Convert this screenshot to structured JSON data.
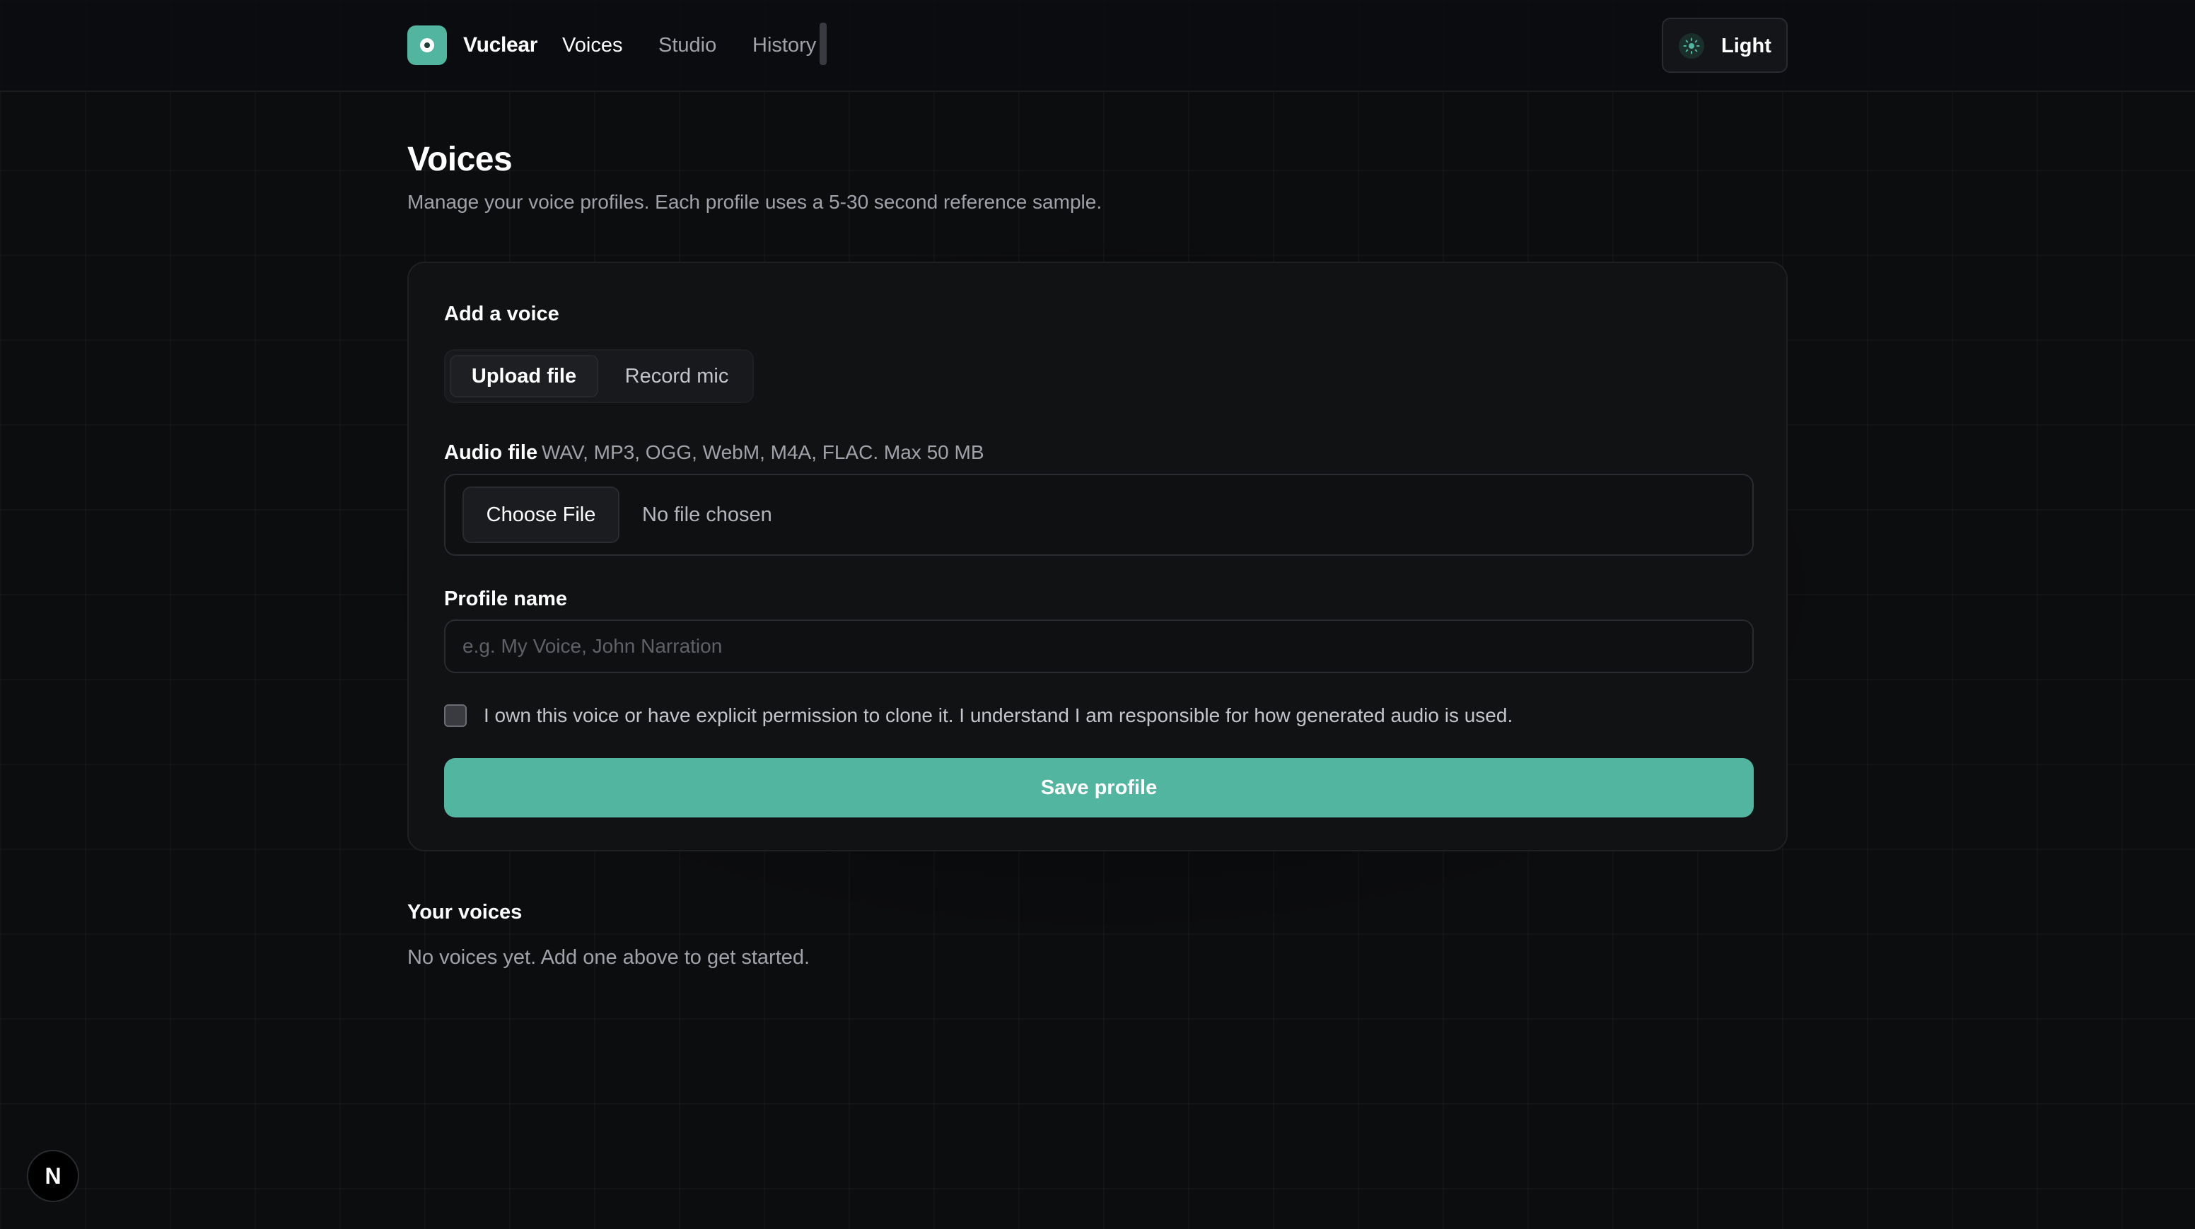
{
  "header": {
    "brand": "Vuclear",
    "nav": [
      {
        "label": "Voices",
        "active": true
      },
      {
        "label": "Studio",
        "active": false
      },
      {
        "label": "History",
        "active": false
      }
    ],
    "theme_toggle": {
      "label": "Light",
      "icon": "sun-icon"
    }
  },
  "page": {
    "title": "Voices",
    "subtitle": "Manage your voice profiles. Each profile uses a 5-30 second reference sample."
  },
  "add_voice": {
    "title": "Add a voice",
    "modes": [
      {
        "label": "Upload file",
        "selected": true
      },
      {
        "label": "Record mic",
        "selected": false
      }
    ],
    "audio_file": {
      "label": "Audio file",
      "hint": "WAV, MP3, OGG, WebM, M4A, FLAC. Max 50 MB",
      "button": "Choose File",
      "status": "No file chosen"
    },
    "profile_name": {
      "label": "Profile name",
      "placeholder": "e.g. My Voice, John Narration",
      "value": ""
    },
    "consent": {
      "checked": false,
      "text": "I own this voice or have explicit permission to clone it. I understand I am responsible for how generated audio is used."
    },
    "save_label": "Save profile"
  },
  "your_voices": {
    "title": "Your voices",
    "empty": "No voices yet. Add one above to get started."
  },
  "dev_badge": {
    "label": "N"
  },
  "colors": {
    "accent": "#52b5a0",
    "background": "#0c0d0f",
    "card": "#111214"
  }
}
